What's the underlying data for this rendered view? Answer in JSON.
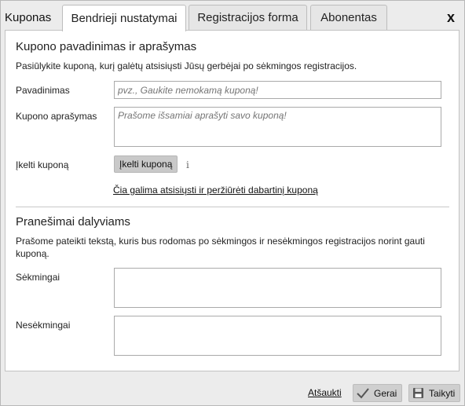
{
  "header": {
    "window_title": "Kuponas",
    "tabs": [
      {
        "label": "Bendrieji nustatymai",
        "active": true
      },
      {
        "label": "Registracijos forma",
        "active": false
      },
      {
        "label": "Abonentas",
        "active": false
      }
    ],
    "close_label": "x"
  },
  "coupon_section": {
    "title": "Kupono pavadinimas ir aprašymas",
    "description": "Pasiūlykite kuponą, kurį galėtų atsisiųsti Jūsų gerbėjai po sėkmingos registracijos.",
    "name_label": "Pavadinimas",
    "name_placeholder": "pvz., Gaukite nemokamą kuponą!",
    "desc_label": "Kupono aprašymas",
    "desc_placeholder": "Prašome išsamiai aprašyti savo kuponą!",
    "upload_label": "Įkelti kuponą",
    "upload_button": "Įkelti kuponą",
    "info_icon": "i",
    "download_link": "Čia galima atsisiųsti ir peržiūrėti dabartinį kuponą"
  },
  "messages_section": {
    "title": "Pranešimai dalyviams",
    "description": "Prašome pateikti tekstą, kuris bus rodomas po sėkmingos ir nesėkmingos registracijos norint gauti kuponą.",
    "success_label": "Sėkmingai",
    "success_value": "",
    "failure_label": "Nesėkmingai",
    "failure_value": ""
  },
  "footer": {
    "cancel_label": "Atšaukti",
    "ok_label": "Gerai",
    "apply_label": "Taikyti"
  },
  "icons": {
    "ok": "checkmark-icon",
    "apply": "floppy-disk-icon",
    "info": "info-icon"
  }
}
